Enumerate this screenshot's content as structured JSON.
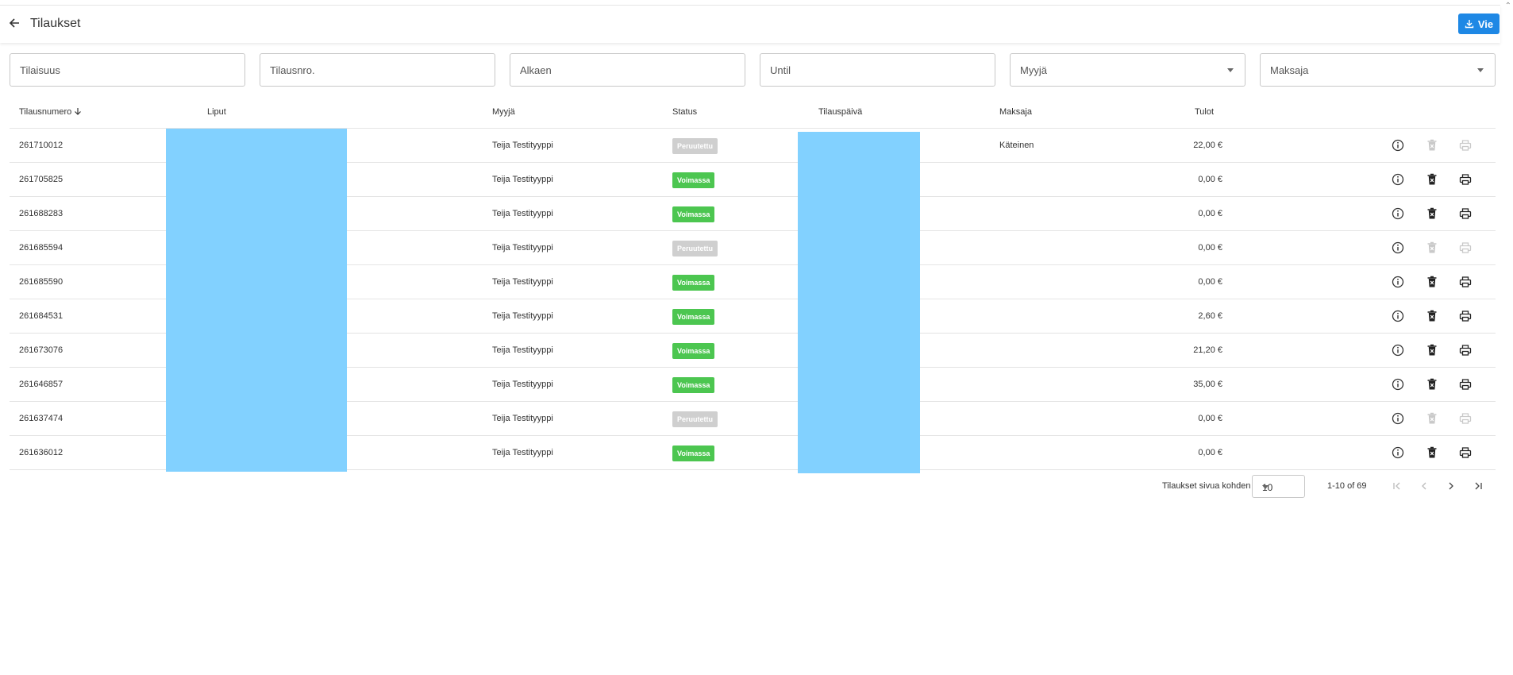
{
  "header": {
    "title": "Tilaukset",
    "export_label": "Vie"
  },
  "filters": {
    "event_placeholder": "Tilaisuus",
    "order_no_placeholder": "Tilausnro.",
    "from_placeholder": "Alkaen",
    "until_placeholder": "Until",
    "seller_label": "Myyjä",
    "payer_label": "Maksaja"
  },
  "table": {
    "columns": [
      "Tilausnumero",
      "Liput",
      "Myyjä",
      "Status",
      "Tilauspäivä",
      "Maksaja",
      "Tulot"
    ],
    "rows": [
      {
        "order_no": "261710012",
        "seller": "Teija Testityyppi",
        "status": "Peruutettu",
        "status_active": false,
        "payer": "Käteinen",
        "income": "22,00 €"
      },
      {
        "order_no": "261705825",
        "seller": "Teija Testityyppi",
        "status": "Voimassa",
        "status_active": true,
        "payer": "",
        "income": "0,00 €"
      },
      {
        "order_no": "261688283",
        "seller": "Teija Testityyppi",
        "status": "Voimassa",
        "status_active": true,
        "payer": "",
        "income": "0,00 €"
      },
      {
        "order_no": "261685594",
        "seller": "Teija Testityyppi",
        "status": "Peruutettu",
        "status_active": false,
        "payer": "",
        "income": "0,00 €"
      },
      {
        "order_no": "261685590",
        "seller": "Teija Testityyppi",
        "status": "Voimassa",
        "status_active": true,
        "payer": "",
        "income": "0,00 €"
      },
      {
        "order_no": "261684531",
        "seller": "Teija Testityyppi",
        "status": "Voimassa",
        "status_active": true,
        "payer": "",
        "income": "2,60 €"
      },
      {
        "order_no": "261673076",
        "seller": "Teija Testityyppi",
        "status": "Voimassa",
        "status_active": true,
        "payer": "",
        "income": "21,20 €"
      },
      {
        "order_no": "261646857",
        "seller": "Teija Testityyppi",
        "status": "Voimassa",
        "status_active": true,
        "payer": "",
        "income": "35,00 €"
      },
      {
        "order_no": "261637474",
        "seller": "Teija Testityyppi",
        "status": "Peruutettu",
        "status_active": false,
        "payer": "",
        "income": "0,00 €"
      },
      {
        "order_no": "261636012",
        "seller": "Teija Testityyppi",
        "status": "Voimassa",
        "status_active": true,
        "payer": "",
        "income": "0,00 €"
      }
    ]
  },
  "icons": {
    "back": "arrow-left-icon",
    "export": "download-icon",
    "sort": "arrow-down-icon",
    "info": "info-icon",
    "cancel": "delete-x-icon",
    "print": "printer-icon"
  },
  "pagination": {
    "per_page_label": "Tilaukset sivua kohden",
    "per_page_value": "10",
    "range": "1-10 of 69"
  },
  "colors": {
    "accent": "#1e88e5",
    "status_active": "#4cc650",
    "status_cancelled": "#cfcfcf",
    "redaction": "#82d1ff"
  }
}
